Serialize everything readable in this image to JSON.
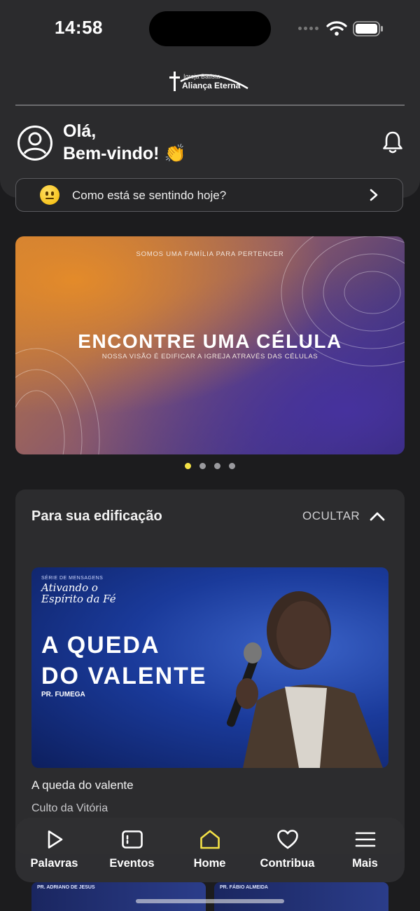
{
  "status_bar": {
    "time": "14:58"
  },
  "header": {
    "logo_line1": "Igreja Batista",
    "logo_line2": "Aliança Eterna",
    "greeting_line1": "Olá,",
    "greeting_line2": "Bem-vindo! 👏"
  },
  "mood": {
    "prompt": "Como está se sentindo hoje?"
  },
  "banner": {
    "small_text": "SOMOS UMA FAMÍLIA PARA PERTENCER",
    "title": "ENCONTRE UMA CÉLULA",
    "subtitle": "NOSSA VISÃO É EDIFICAR A IGREJA ATRAVÉS DAS CÉLULAS",
    "pages": 4,
    "active_page": 1
  },
  "edification": {
    "title": "Para sua edificação",
    "toggle_label": "OCULTAR",
    "item": {
      "series_small": "SÉRIE DE MENSAGENS",
      "series_line1": "Ativando o",
      "series_line2": "Espírito da Fé",
      "thumb_title1": "A QUEDA",
      "thumb_title2": "DO VALENTE",
      "thumb_preacher": "PR. FUMEGA",
      "title": "A queda do valente",
      "subtitle": "Culto da Vitória"
    },
    "next_items": [
      "PR. ADRIANO DE JESUS",
      "PR. FÁBIO ALMEIDA"
    ]
  },
  "tabs": [
    {
      "label": "Palavras",
      "icon": "play-icon"
    },
    {
      "label": "Eventos",
      "icon": "calendar-icon"
    },
    {
      "label": "Home",
      "icon": "home-icon",
      "active": true
    },
    {
      "label": "Contribua",
      "icon": "heart-icon"
    },
    {
      "label": "Mais",
      "icon": "menu-icon"
    }
  ],
  "colors": {
    "accent": "#f3e146",
    "background": "#1c1c1e",
    "card": "#2c2c2e"
  }
}
